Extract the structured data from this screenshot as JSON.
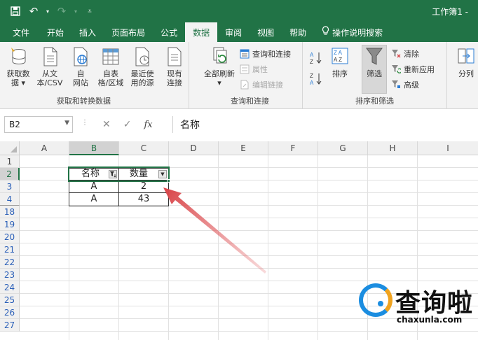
{
  "window": {
    "title": "工作簿1 -"
  },
  "qat": {
    "save_icon": "save-icon",
    "undo_icon": "undo-icon",
    "redo_icon": "redo-icon",
    "customize_icon": "customize-icon"
  },
  "tabs": [
    {
      "label": "文件"
    },
    {
      "label": "开始"
    },
    {
      "label": "插入"
    },
    {
      "label": "页面布局"
    },
    {
      "label": "公式"
    },
    {
      "label": "数据"
    },
    {
      "label": "审阅"
    },
    {
      "label": "视图"
    },
    {
      "label": "帮助"
    },
    {
      "label": "操作说明搜索"
    }
  ],
  "ribbon": {
    "get_data": {
      "line1": "获取数",
      "line2": "据 ▾"
    },
    "from_text": {
      "line1": "从文",
      "line2": "本/CSV"
    },
    "from_web": {
      "line1": "自",
      "line2": "网站"
    },
    "from_table": {
      "line1": "自表",
      "line2": "格/区域"
    },
    "recent_sources": {
      "line1": "最近使",
      "line2": "用的源"
    },
    "existing": {
      "line1": "现有",
      "line2": "连接"
    },
    "group_get": "获取和转换数据",
    "refresh_all": {
      "line1": "全部刷新",
      "line2": "▾"
    },
    "queries_connections": "查询和连接",
    "properties": "属性",
    "edit_links": "编辑链接",
    "group_queries": "查询和连接",
    "sort": "排序",
    "filter": "筛选",
    "clear": "清除",
    "reapply": "重新应用",
    "advanced": "高级",
    "group_sort": "排序和筛选",
    "split": "分列"
  },
  "formula_bar": {
    "name_box": "B2",
    "fx": "fx",
    "content": "名称"
  },
  "columns": [
    "A",
    "B",
    "C",
    "D",
    "E",
    "F",
    "G",
    "H",
    "I"
  ],
  "rows": [
    "1",
    "2",
    "3",
    "4",
    "18",
    "19",
    "20",
    "21",
    "22",
    "23",
    "24",
    "25",
    "26",
    "27"
  ],
  "table": {
    "header": [
      "名称",
      "数量"
    ],
    "rows": [
      [
        "A",
        "2"
      ],
      [
        "A",
        "43"
      ]
    ]
  },
  "watermark": {
    "text": "查询啦",
    "url": "chaxunla.com"
  },
  "colors": {
    "excel_green": "#217346",
    "arrow_red": "#d9464a",
    "filter_row_blue": "#2a5fb8"
  }
}
